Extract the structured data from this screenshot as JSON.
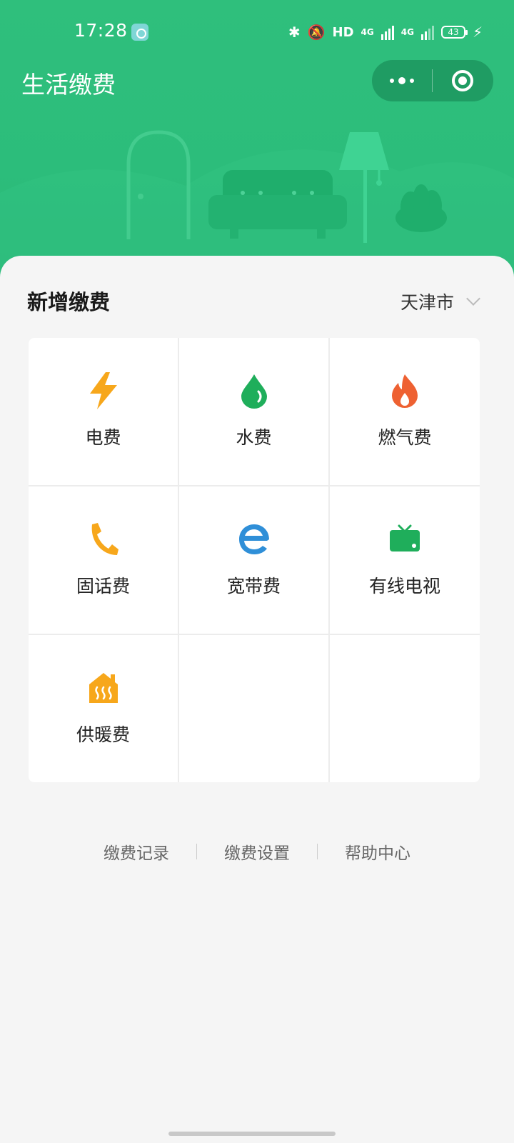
{
  "status_bar": {
    "time": "17:28",
    "network_label": "HD",
    "signal_1": "4G",
    "signal_2": "4G",
    "battery": "43"
  },
  "header": {
    "title": "生活缴费"
  },
  "section": {
    "title": "新增缴费",
    "city": "天津市"
  },
  "services": [
    {
      "label": "电费",
      "icon": "lightning-icon",
      "color": "#f7a71b"
    },
    {
      "label": "水费",
      "icon": "water-drop-icon",
      "color": "#1fae5b"
    },
    {
      "label": "燃气费",
      "icon": "flame-icon",
      "color": "#ee6132"
    },
    {
      "label": "固话费",
      "icon": "phone-icon",
      "color": "#f7a71b"
    },
    {
      "label": "宽带费",
      "icon": "broadband-e-icon",
      "color": "#2f8fd8"
    },
    {
      "label": "有线电视",
      "icon": "tv-icon",
      "color": "#1fae5b"
    },
    {
      "label": "供暖费",
      "icon": "heating-house-icon",
      "color": "#f7a71b"
    }
  ],
  "footer": {
    "records": "缴费记录",
    "settings": "缴费设置",
    "help": "帮助中心"
  },
  "colors": {
    "header_green": "#2cbd7b",
    "capsule_green": "#1f9c63"
  }
}
